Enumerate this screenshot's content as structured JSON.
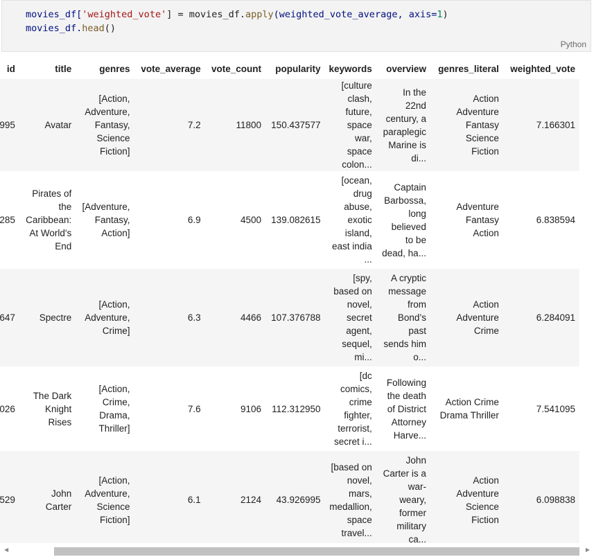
{
  "code_cell": {
    "line1": {
      "var": "movies_df[",
      "str": "'weighted_vote'",
      "rest": "] = movies_df.",
      "fn": "apply",
      "args_open": "(weighted_vote_average, axis=",
      "num": "1",
      "close": ")"
    },
    "line2": {
      "var": "movies_df.",
      "fn": "head",
      "close": "()"
    },
    "language": "Python"
  },
  "table": {
    "columns": [
      "id",
      "title",
      "genres",
      "vote_average",
      "vote_count",
      "popularity",
      "keywords",
      "overview",
      "genres_literal",
      "weighted_vote"
    ],
    "rows": [
      {
        "id": "995",
        "title": [
          "Avatar"
        ],
        "genres": [
          "[Action,",
          "Adventure,",
          "Fantasy,",
          "Science",
          "Fiction]"
        ],
        "vote_average": "7.2",
        "vote_count": "11800",
        "popularity": "150.437577",
        "keywords": [
          "[culture",
          "clash,",
          "future,",
          "space war,",
          "space",
          "colon..."
        ],
        "overview": [
          "In the",
          "22nd",
          "century, a",
          "paraplegic",
          "Marine is",
          "di..."
        ],
        "genres_literal": [
          "Action",
          "Adventure",
          "Fantasy",
          "Science",
          "Fiction"
        ],
        "weighted_vote": "7.166301"
      },
      {
        "id": "285",
        "title": [
          "Pirates of",
          "the",
          "Caribbean:",
          "At World's",
          "End"
        ],
        "genres": [
          "[Adventure,",
          "Fantasy,",
          "Action]"
        ],
        "vote_average": "6.9",
        "vote_count": "4500",
        "popularity": "139.082615",
        "keywords": [
          "[ocean,",
          "drug",
          "abuse,",
          "exotic",
          "island,",
          "east india",
          "..."
        ],
        "overview": [
          "Captain",
          "Barbossa,",
          "long",
          "believed",
          "to be",
          "dead, ha..."
        ],
        "genres_literal": [
          "Adventure",
          "Fantasy",
          "Action"
        ],
        "weighted_vote": "6.838594"
      },
      {
        "id": "647",
        "title": [
          "Spectre"
        ],
        "genres": [
          "[Action,",
          "Adventure,",
          "Crime]"
        ],
        "vote_average": "6.3",
        "vote_count": "4466",
        "popularity": "107.376788",
        "keywords": [
          "[spy,",
          "based on",
          "novel,",
          "secret",
          "agent,",
          "sequel,",
          "mi..."
        ],
        "overview": [
          "A cryptic",
          "message",
          "from",
          "Bond’s",
          "past",
          "sends him",
          "o..."
        ],
        "genres_literal": [
          "Action",
          "Adventure",
          "Crime"
        ],
        "weighted_vote": "6.284091"
      },
      {
        "id": "026",
        "title": [
          "The Dark",
          "Knight",
          "Rises"
        ],
        "genres": [
          "[Action,",
          "Crime,",
          "Drama,",
          "Thriller]"
        ],
        "vote_average": "7.6",
        "vote_count": "9106",
        "popularity": "112.312950",
        "keywords": [
          "[dc",
          "comics,",
          "crime",
          "fighter,",
          "terrorist,",
          "secret i..."
        ],
        "overview": [
          "Following",
          "the death",
          "of District",
          "Attorney",
          "Harve..."
        ],
        "genres_literal": [
          "Action Crime",
          "Drama Thriller"
        ],
        "weighted_vote": "7.541095"
      },
      {
        "id": "529",
        "title": [
          "John",
          "Carter"
        ],
        "genres": [
          "[Action,",
          "Adventure,",
          "Science",
          "Fiction]"
        ],
        "vote_average": "6.1",
        "vote_count": "2124",
        "popularity": "43.926995",
        "keywords": [
          "[based on",
          "novel,",
          "mars,",
          "medallion,",
          "space",
          "travel..."
        ],
        "overview": [
          "John",
          "Carter is a",
          "war-",
          "weary,",
          "former",
          "military",
          "ca..."
        ],
        "genres_literal": [
          "Action",
          "Adventure",
          "Science",
          "Fiction"
        ],
        "weighted_vote": "6.098838"
      }
    ]
  },
  "scrollbar": {
    "left_arrow_icon": "triangle-left",
    "right_arrow_icon": "triangle-right"
  }
}
